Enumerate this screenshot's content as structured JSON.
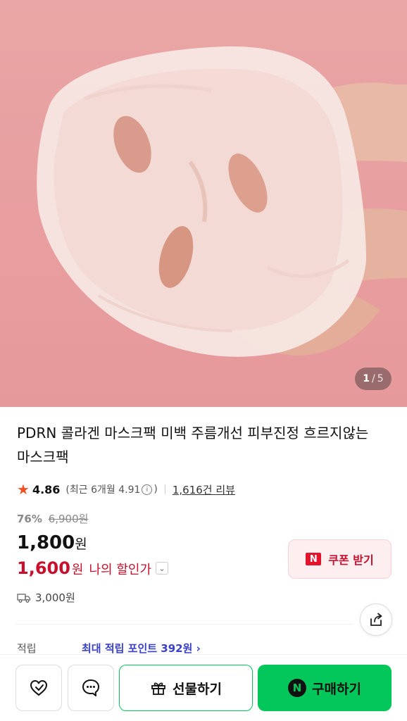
{
  "gallery": {
    "current": "1",
    "separator": "/",
    "total": "5"
  },
  "product": {
    "title": "PDRN 콜라겐 마스크팩 미백 주름개선 피부진정 흐르지않는 마스크팩"
  },
  "rating": {
    "score": "4.86",
    "recent_label": "(최근 6개월 4.91",
    "recent_close": ")",
    "info_icon": "ⓘ",
    "reviews": "1,616건 리뷰"
  },
  "price": {
    "discount_pct": "76%",
    "original": "6,900원",
    "sale_number": "1,800",
    "currency": "원",
    "my_price_number": "1,600",
    "my_price_label": "나의 할인가"
  },
  "coupon": {
    "logo": "N",
    "label": "쿠폰 받기"
  },
  "shipping": {
    "fee": "3,000원"
  },
  "points": {
    "label": "적립",
    "value": "최대 적립 포인트 392원 ›"
  },
  "actions": {
    "gift_label": "선물하기",
    "buy_logo": "N",
    "buy_label": "구매하기"
  },
  "colors": {
    "accent_green": "#03c75a",
    "price_red": "#c8102e",
    "star": "#f04e23",
    "points_blue": "#3a40c8"
  }
}
